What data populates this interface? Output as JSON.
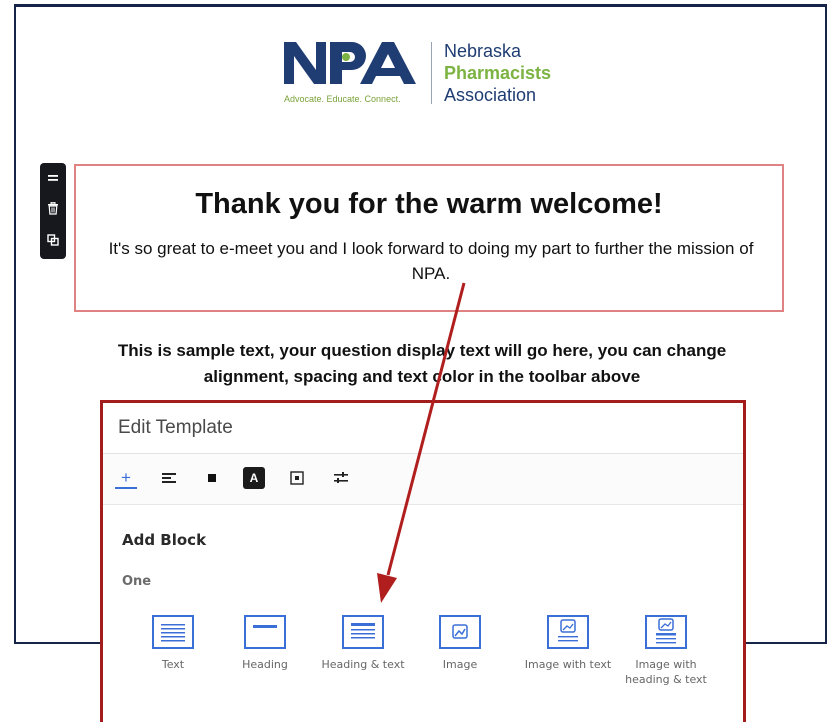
{
  "logo": {
    "mark": "NPA",
    "tagline": "Advocate. Educate. Connect.",
    "name_line1": "Nebraska",
    "name_line2": "Pharmacists",
    "name_line3": "Association",
    "colors": {
      "navy": "#1f3c73",
      "green": "#7cb342"
    }
  },
  "block_toolbar": {
    "icons": [
      "drag-handle-icon",
      "trash-icon",
      "duplicate-icon"
    ]
  },
  "content": {
    "headline": "Thank you for the warm welcome!",
    "subtext": "It's so great to e-meet you and I look forward to doing my part to further the mission of NPA.",
    "sample_text": "This is sample text, your question display text will go here, you can change alignment, spacing and text color in the toolbar above"
  },
  "panel": {
    "title": "Edit Template",
    "tabs": [
      {
        "name": "add",
        "glyph": "+"
      },
      {
        "name": "align",
        "glyph": "≡"
      },
      {
        "name": "background",
        "glyph": "■"
      },
      {
        "name": "text-color",
        "glyph": "A"
      },
      {
        "name": "padding",
        "glyph": "⊡"
      },
      {
        "name": "settings",
        "glyph": "⇌"
      }
    ],
    "add_block_title": "Add Block",
    "group_label": "One",
    "blocks": [
      {
        "label": "Text",
        "icon": "text-block-icon"
      },
      {
        "label": "Heading",
        "icon": "heading-block-icon"
      },
      {
        "label": "Heading & text",
        "icon": "heading-text-block-icon"
      },
      {
        "label": "Image",
        "icon": "image-block-icon"
      },
      {
        "label": "Image with text",
        "icon": "image-text-block-icon"
      },
      {
        "label": "Image with heading & text",
        "icon": "image-heading-text-block-icon"
      }
    ]
  },
  "colors": {
    "frame_border": "#162447",
    "selection_border": "#e08282",
    "panel_border": "#a41d1d",
    "accent_blue": "#3b6fd8",
    "arrow": "#b01e1e"
  }
}
